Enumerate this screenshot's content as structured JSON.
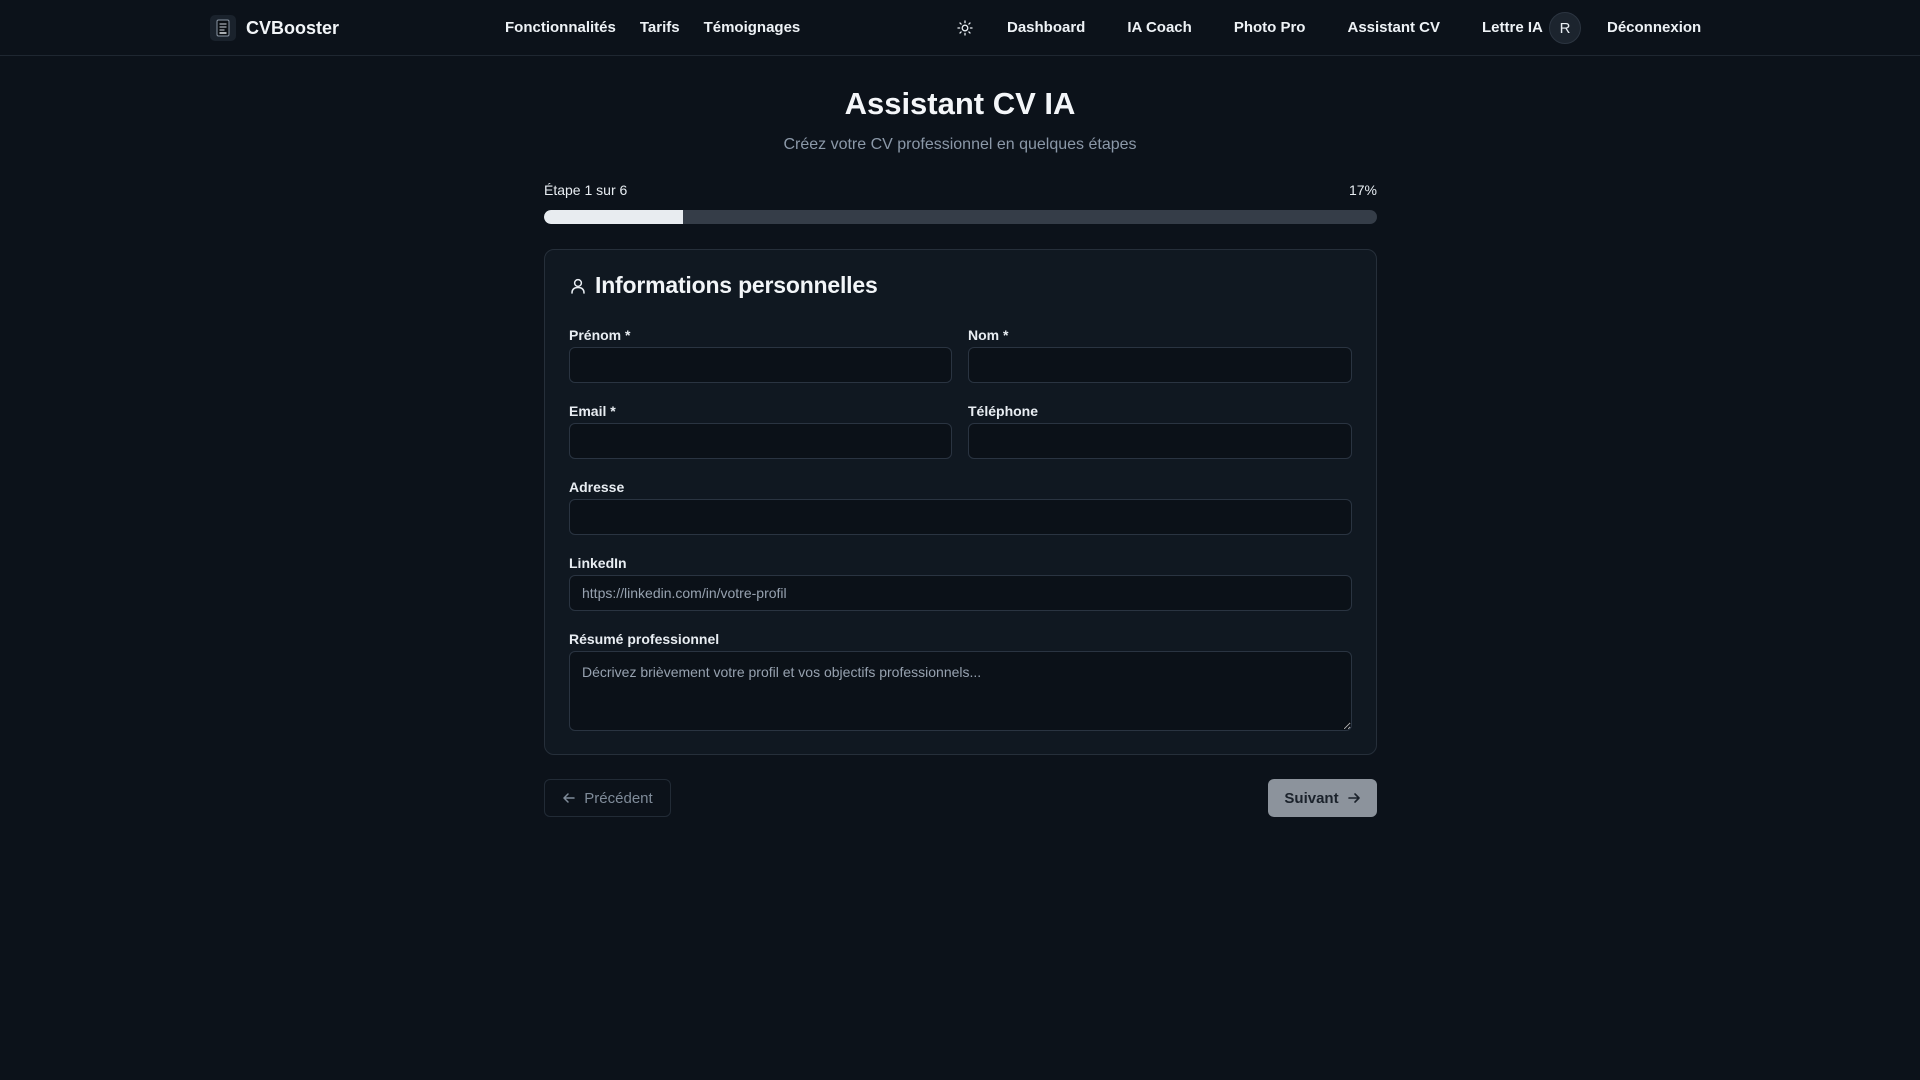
{
  "nav": {
    "brand": "CVBooster",
    "left_links": [
      "Fonctionnalités",
      "Tarifs",
      "Témoignages"
    ],
    "right_links": [
      "Dashboard",
      "IA Coach",
      "Photo Pro",
      "Assistant CV",
      "Lettre IA"
    ],
    "avatar_initial": "R",
    "logout": "Déconnexion",
    "theme_icon": "sun-icon"
  },
  "header": {
    "title": "Assistant CV IA",
    "subtitle": "Créez votre CV professionnel en quelques étapes"
  },
  "progress": {
    "step_text": "Étape 1 sur 6",
    "percent_text": "17%",
    "fraction": 0.167
  },
  "card": {
    "title": "Informations personnelles",
    "icon": "user-icon",
    "fields": {
      "prenom": {
        "label": "Prénom *",
        "value": "",
        "placeholder": ""
      },
      "nom": {
        "label": "Nom *",
        "value": "",
        "placeholder": ""
      },
      "email": {
        "label": "Email *",
        "value": "",
        "placeholder": ""
      },
      "telephone": {
        "label": "Téléphone",
        "value": "",
        "placeholder": ""
      },
      "adresse": {
        "label": "Adresse",
        "value": "",
        "placeholder": ""
      },
      "linkedin": {
        "label": "LinkedIn",
        "value": "",
        "placeholder": "https://linkedin.com/in/votre-profil"
      },
      "resume": {
        "label": "Résumé professionnel",
        "value": "",
        "placeholder": "Décrivez brièvement votre profil et vos objectifs professionnels..."
      }
    }
  },
  "buttons": {
    "previous": "Précédent",
    "next": "Suivant"
  },
  "colors": {
    "background": "#0c121a",
    "card": "#101821",
    "progress_fill": "#e8ecf0",
    "next_button": "#8c939c"
  }
}
